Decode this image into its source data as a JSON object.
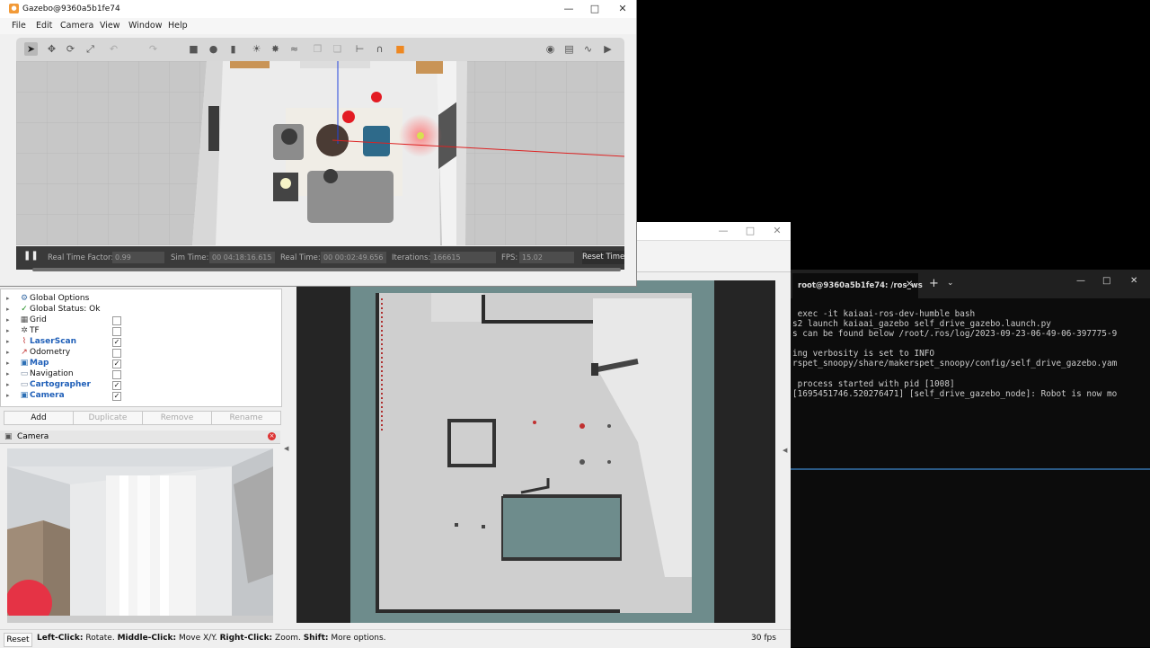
{
  "gazebo": {
    "title": "Gazebo@9360a5b1fe74",
    "menus": [
      "File",
      "Edit",
      "Camera",
      "View",
      "Window",
      "Help"
    ],
    "stats": {
      "real_time_factor_label": "Real Time Factor:",
      "real_time_factor": "0.99",
      "sim_time_label": "Sim Time:",
      "sim_time": "00 04:18:16.615",
      "real_time_label": "Real Time:",
      "real_time": "00 00:02:49.656",
      "iterations_label": "Iterations:",
      "iterations": "166615",
      "fps_label": "FPS:",
      "fps": "15.02",
      "reset_time": "Reset Time"
    }
  },
  "rviz": {
    "displays": [
      {
        "label": "Global Options",
        "icon": "gear-icon",
        "checked": null,
        "highlight": false
      },
      {
        "label": "Global Status: Ok",
        "icon": "check-icon",
        "checked": null,
        "highlight": false
      },
      {
        "label": "Grid",
        "icon": "grid-icon",
        "checked": false,
        "highlight": false
      },
      {
        "label": "TF",
        "icon": "tf-icon",
        "checked": false,
        "highlight": false
      },
      {
        "label": "LaserScan",
        "icon": "laserscan-icon",
        "checked": true,
        "highlight": true
      },
      {
        "label": "Odometry",
        "icon": "odometry-icon",
        "checked": false,
        "highlight": false
      },
      {
        "label": "Map",
        "icon": "map-icon",
        "checked": true,
        "highlight": true
      },
      {
        "label": "Navigation",
        "icon": "folder-icon",
        "checked": false,
        "highlight": false
      },
      {
        "label": "Cartographer",
        "icon": "folder-icon",
        "checked": true,
        "highlight": true
      },
      {
        "label": "Camera",
        "icon": "camera-icon",
        "checked": true,
        "highlight": true
      }
    ],
    "buttons": {
      "add": "Add",
      "duplicate": "Duplicate",
      "remove": "Remove",
      "rename": "Rename"
    },
    "camera_panel_title": "Camera",
    "status": {
      "reset": "Reset",
      "left_click": "Left-Click:",
      "left_click_desc": " Rotate. ",
      "middle_click": "Middle-Click:",
      "middle_click_desc": " Move X/Y. ",
      "right_click": "Right-Click:",
      "right_click_desc": " Zoom. ",
      "shift": "Shift:",
      "shift_desc": " More options.",
      "fps": "30 fps"
    }
  },
  "terminal": {
    "tab_title": "root@9360a5b1fe74: /ros_ws",
    "lines": [
      " exec -it kaiaai-ros-dev-humble bash",
      "s2 launch kaiaai_gazebo self_drive_gazebo.launch.py",
      "s can be found below /root/.ros/log/2023-09-23-06-49-06-397775-9",
      "",
      "ing verbosity is set to INFO",
      "rspet_snoopy/share/makerspet_snoopy/config/self_drive_gazebo.yam",
      "",
      " process started with pid [1008]",
      "[1695451746.520276471] [self_drive_gazebo_node]: Robot is now mo"
    ]
  }
}
